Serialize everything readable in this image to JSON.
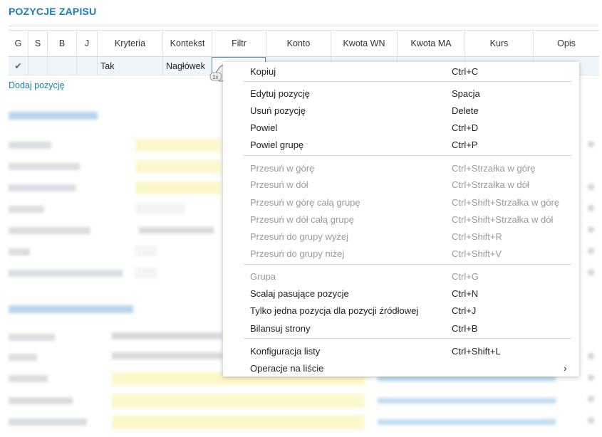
{
  "section": {
    "title": "POZYCJE ZAPISU"
  },
  "grid": {
    "headers": [
      "G",
      "S",
      "B",
      "J",
      "Kryteria",
      "Kontekst",
      "Filtr",
      "Konto",
      "Kwota WN",
      "Kwota MA",
      "Kurs",
      "Opis"
    ],
    "row": [
      "✔",
      "",
      "",
      "",
      "Tak",
      "Nagłówek",
      "",
      "",
      "",
      "",
      "",
      ""
    ]
  },
  "add_link": "Dodaj pozycję",
  "cursor_badge": "1x",
  "context_menu": {
    "items": [
      {
        "label": "Kopiuj",
        "shortcut": "Ctrl+C",
        "disabled": false
      },
      {
        "label": "Edytuj pozycję",
        "shortcut": "Spacja",
        "disabled": false
      },
      {
        "label": "Usuń pozycję",
        "shortcut": "Delete",
        "disabled": false
      },
      {
        "label": "Powiel",
        "shortcut": "Ctrl+D",
        "disabled": false
      },
      {
        "label": "Powiel grupę",
        "shortcut": "Ctrl+P",
        "disabled": false
      },
      {
        "label": "Przesuń w górę",
        "shortcut": "Ctrl+Strzałka w górę",
        "disabled": true
      },
      {
        "label": "Przesuń w dół",
        "shortcut": "Ctrl+Strzałka w dół",
        "disabled": true
      },
      {
        "label": "Przesuń w górę całą grupę",
        "shortcut": "Ctrl+Shift+Strzałka w górę",
        "disabled": true
      },
      {
        "label": "Przesuń w dół całą grupę",
        "shortcut": "Ctrl+Shift+Strzałka w dół",
        "disabled": true
      },
      {
        "label": "Przesuń do grupy wyżej",
        "shortcut": "Ctrl+Shift+R",
        "disabled": true
      },
      {
        "label": "Przesuń do grupy niżej",
        "shortcut": "Ctrl+Shift+V",
        "disabled": true
      },
      {
        "label": "Grupa",
        "shortcut": "Ctrl+G",
        "disabled": true
      },
      {
        "label": "Scalaj pasujące pozycje",
        "shortcut": "Ctrl+N",
        "disabled": false
      },
      {
        "label": "Tylko jedna pozycja dla pozycji źródłowej",
        "shortcut": "Ctrl+J",
        "disabled": false
      },
      {
        "label": "Bilansuj strony",
        "shortcut": "Ctrl+B",
        "disabled": false
      },
      {
        "label": "Konfiguracja listy",
        "shortcut": "Ctrl+Shift+L",
        "disabled": false
      },
      {
        "label": "Operacje na liście",
        "shortcut": "›",
        "disabled": false
      }
    ]
  },
  "colors": {
    "accent": "#1a7bb9",
    "disabled_text": "#9a9a9a",
    "row_highlight": "#eef6fb"
  }
}
